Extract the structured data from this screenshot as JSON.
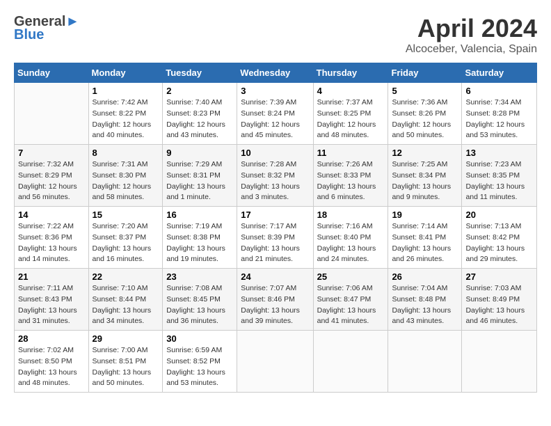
{
  "header": {
    "logo_line1_part1": "General",
    "logo_line2": "Blue",
    "month_title": "April 2024",
    "location": "Alcoceber, Valencia, Spain"
  },
  "weekdays": [
    "Sunday",
    "Monday",
    "Tuesday",
    "Wednesday",
    "Thursday",
    "Friday",
    "Saturday"
  ],
  "weeks": [
    [
      {
        "num": "",
        "info": ""
      },
      {
        "num": "1",
        "info": "Sunrise: 7:42 AM\nSunset: 8:22 PM\nDaylight: 12 hours\nand 40 minutes."
      },
      {
        "num": "2",
        "info": "Sunrise: 7:40 AM\nSunset: 8:23 PM\nDaylight: 12 hours\nand 43 minutes."
      },
      {
        "num": "3",
        "info": "Sunrise: 7:39 AM\nSunset: 8:24 PM\nDaylight: 12 hours\nand 45 minutes."
      },
      {
        "num": "4",
        "info": "Sunrise: 7:37 AM\nSunset: 8:25 PM\nDaylight: 12 hours\nand 48 minutes."
      },
      {
        "num": "5",
        "info": "Sunrise: 7:36 AM\nSunset: 8:26 PM\nDaylight: 12 hours\nand 50 minutes."
      },
      {
        "num": "6",
        "info": "Sunrise: 7:34 AM\nSunset: 8:28 PM\nDaylight: 12 hours\nand 53 minutes."
      }
    ],
    [
      {
        "num": "7",
        "info": "Sunrise: 7:32 AM\nSunset: 8:29 PM\nDaylight: 12 hours\nand 56 minutes."
      },
      {
        "num": "8",
        "info": "Sunrise: 7:31 AM\nSunset: 8:30 PM\nDaylight: 12 hours\nand 58 minutes."
      },
      {
        "num": "9",
        "info": "Sunrise: 7:29 AM\nSunset: 8:31 PM\nDaylight: 13 hours\nand 1 minute."
      },
      {
        "num": "10",
        "info": "Sunrise: 7:28 AM\nSunset: 8:32 PM\nDaylight: 13 hours\nand 3 minutes."
      },
      {
        "num": "11",
        "info": "Sunrise: 7:26 AM\nSunset: 8:33 PM\nDaylight: 13 hours\nand 6 minutes."
      },
      {
        "num": "12",
        "info": "Sunrise: 7:25 AM\nSunset: 8:34 PM\nDaylight: 13 hours\nand 9 minutes."
      },
      {
        "num": "13",
        "info": "Sunrise: 7:23 AM\nSunset: 8:35 PM\nDaylight: 13 hours\nand 11 minutes."
      }
    ],
    [
      {
        "num": "14",
        "info": "Sunrise: 7:22 AM\nSunset: 8:36 PM\nDaylight: 13 hours\nand 14 minutes."
      },
      {
        "num": "15",
        "info": "Sunrise: 7:20 AM\nSunset: 8:37 PM\nDaylight: 13 hours\nand 16 minutes."
      },
      {
        "num": "16",
        "info": "Sunrise: 7:19 AM\nSunset: 8:38 PM\nDaylight: 13 hours\nand 19 minutes."
      },
      {
        "num": "17",
        "info": "Sunrise: 7:17 AM\nSunset: 8:39 PM\nDaylight: 13 hours\nand 21 minutes."
      },
      {
        "num": "18",
        "info": "Sunrise: 7:16 AM\nSunset: 8:40 PM\nDaylight: 13 hours\nand 24 minutes."
      },
      {
        "num": "19",
        "info": "Sunrise: 7:14 AM\nSunset: 8:41 PM\nDaylight: 13 hours\nand 26 minutes."
      },
      {
        "num": "20",
        "info": "Sunrise: 7:13 AM\nSunset: 8:42 PM\nDaylight: 13 hours\nand 29 minutes."
      }
    ],
    [
      {
        "num": "21",
        "info": "Sunrise: 7:11 AM\nSunset: 8:43 PM\nDaylight: 13 hours\nand 31 minutes."
      },
      {
        "num": "22",
        "info": "Sunrise: 7:10 AM\nSunset: 8:44 PM\nDaylight: 13 hours\nand 34 minutes."
      },
      {
        "num": "23",
        "info": "Sunrise: 7:08 AM\nSunset: 8:45 PM\nDaylight: 13 hours\nand 36 minutes."
      },
      {
        "num": "24",
        "info": "Sunrise: 7:07 AM\nSunset: 8:46 PM\nDaylight: 13 hours\nand 39 minutes."
      },
      {
        "num": "25",
        "info": "Sunrise: 7:06 AM\nSunset: 8:47 PM\nDaylight: 13 hours\nand 41 minutes."
      },
      {
        "num": "26",
        "info": "Sunrise: 7:04 AM\nSunset: 8:48 PM\nDaylight: 13 hours\nand 43 minutes."
      },
      {
        "num": "27",
        "info": "Sunrise: 7:03 AM\nSunset: 8:49 PM\nDaylight: 13 hours\nand 46 minutes."
      }
    ],
    [
      {
        "num": "28",
        "info": "Sunrise: 7:02 AM\nSunset: 8:50 PM\nDaylight: 13 hours\nand 48 minutes."
      },
      {
        "num": "29",
        "info": "Sunrise: 7:00 AM\nSunset: 8:51 PM\nDaylight: 13 hours\nand 50 minutes."
      },
      {
        "num": "30",
        "info": "Sunrise: 6:59 AM\nSunset: 8:52 PM\nDaylight: 13 hours\nand 53 minutes."
      },
      {
        "num": "",
        "info": ""
      },
      {
        "num": "",
        "info": ""
      },
      {
        "num": "",
        "info": ""
      },
      {
        "num": "",
        "info": ""
      }
    ]
  ]
}
